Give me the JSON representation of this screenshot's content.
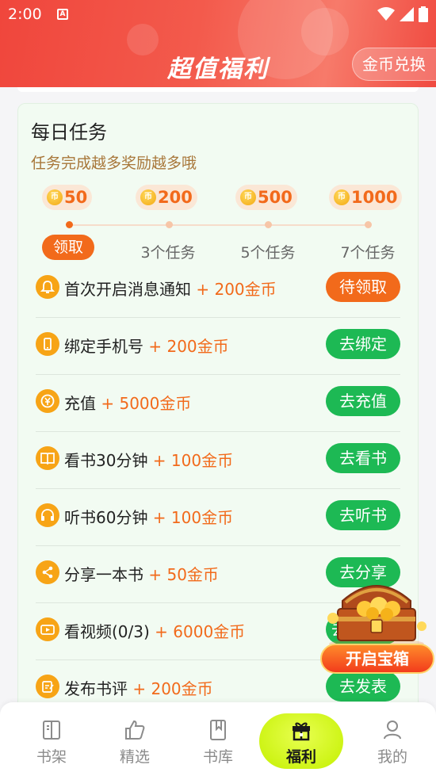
{
  "status_bar": {
    "time": "2:00",
    "notification_icon": "A"
  },
  "header": {
    "title": "超值福利",
    "exchange_label": "金币兑换"
  },
  "daily_tasks": {
    "title": "每日任务",
    "subtitle": "任务完成越多奖励越多哦",
    "milestones": [
      {
        "value": "50",
        "label": "领取",
        "claimable": true
      },
      {
        "value": "200",
        "label": "3个任务",
        "claimable": false
      },
      {
        "value": "500",
        "label": "5个任务",
        "claimable": false
      },
      {
        "value": "1000",
        "label": "7个任务",
        "claimable": false
      }
    ],
    "coin_glyph": "币",
    "tasks": [
      {
        "name": "首次开启消息通知",
        "reward": " + 200金币",
        "button": "待领取",
        "icon": "bell-icon"
      },
      {
        "name": "绑定手机号",
        "reward": " + 200金币",
        "button": "去绑定",
        "icon": "phone-icon"
      },
      {
        "name": "充值",
        "reward": " + 5000金币",
        "button": "去充值",
        "icon": "yen-icon"
      },
      {
        "name": "看书30分钟",
        "reward": " + 100金币",
        "button": "去看书",
        "icon": "book-icon"
      },
      {
        "name": "听书60分钟",
        "reward": " + 100金币",
        "button": "去听书",
        "icon": "headphones-icon"
      },
      {
        "name": "分享一本书",
        "reward": " + 50金币",
        "button": "去分享",
        "icon": "share-icon"
      },
      {
        "name": "看视频",
        "progress": "(0/3)",
        "reward": " + 6000金币",
        "button": "去看视频",
        "icon": "video-icon"
      },
      {
        "name": "发布书评",
        "reward": " + 200金币",
        "button": "去发表",
        "icon": "edit-icon"
      }
    ]
  },
  "treasure": {
    "label": "开启宝箱"
  },
  "bottom_nav": {
    "items": [
      {
        "label": "书架",
        "icon": "bookshelf-icon"
      },
      {
        "label": "精选",
        "icon": "thumbs-up-icon"
      },
      {
        "label": "书库",
        "icon": "library-icon"
      },
      {
        "label": "福利",
        "icon": "gift-icon",
        "active": true
      },
      {
        "label": "我的",
        "icon": "profile-icon"
      }
    ]
  },
  "colors": {
    "accent": "#f26a1b",
    "primary_green": "#1db954",
    "header_red": "#f0463c"
  }
}
